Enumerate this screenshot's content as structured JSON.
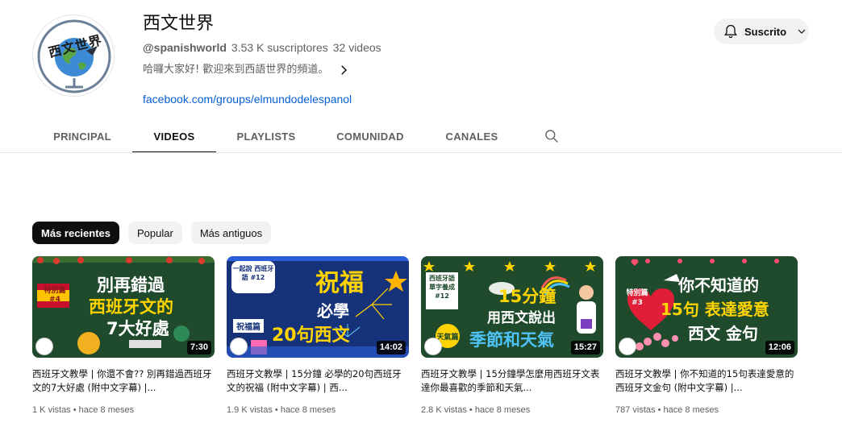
{
  "channel": {
    "name": "西文世界",
    "handle": "@spanishworld",
    "subscribers": "3.53 K suscriptores",
    "video_count": "32 videos",
    "description": "哈囉大家好! 歡迎來到西語世界的頻道。",
    "link": "facebook.com/groups/elmundodelespanol",
    "avatar_text": "西文世界",
    "subscribe_label": "Suscrito"
  },
  "tabs": [
    {
      "label": "PRINCIPAL"
    },
    {
      "label": "VIDEOS"
    },
    {
      "label": "PLAYLISTS"
    },
    {
      "label": "COMUNIDAD"
    },
    {
      "label": "CANALES"
    }
  ],
  "chips": [
    {
      "label": "Más recientes"
    },
    {
      "label": "Popular"
    },
    {
      "label": "Más antiguos"
    }
  ],
  "videos": [
    {
      "title": "西班牙文教學 | 你還不會?? 別再錯過西班牙文的7大好處 (附中文字幕) |...",
      "stats": "1 K vistas • hace 8 meses",
      "duration": "7:30",
      "thumb_lines": [
        "別再錯過",
        "西班牙文的",
        "7大好處"
      ],
      "thumb_badge": "特別篇 #4"
    },
    {
      "title": "西班牙文教學 | 15分鐘 必學的20句西班牙文的祝福 (附中文字幕) | 西...",
      "stats": "1.9 K vistas • hace 8 meses",
      "duration": "14:02",
      "thumb_lines": [
        "祝福",
        "必學",
        "20句西文"
      ],
      "thumb_badge": "一起說 西班牙語 #12",
      "thumb_tag": "祝福篇"
    },
    {
      "title": "西班牙文教學 | 15分鐘學怎麼用西班牙文表達你最喜歡的季節和天氣...",
      "stats": "2.8 K vistas • hace 8 meses",
      "duration": "15:27",
      "thumb_lines": [
        "15分鐘",
        "用西文說出",
        "季節和天氣"
      ],
      "thumb_badge": "西班牙語 單字養成 #12",
      "thumb_tag": "天氣篇"
    },
    {
      "title": "西班牙文教學 | 你不知道的15句表達愛意的西班牙文金句 (附中文字幕) |...",
      "stats": "787 vistas • hace 8 meses",
      "duration": "12:06",
      "thumb_lines": [
        "你不知道的",
        "15句 表達愛意",
        "西文 金句"
      ],
      "thumb_badge": "特別篇 #3"
    }
  ],
  "colors": {
    "link": "#065fd4",
    "chalkboard": "#1f4a2c",
    "navy": "#16327a",
    "yellow": "#ffd400"
  }
}
